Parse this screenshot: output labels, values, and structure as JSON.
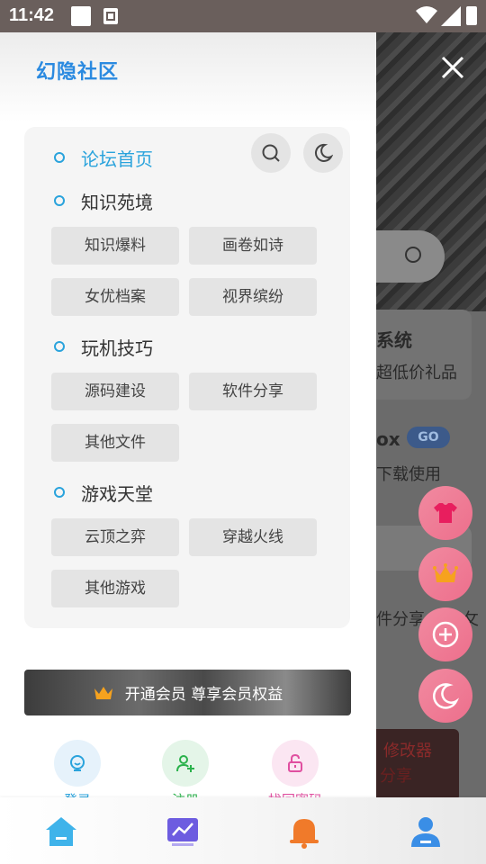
{
  "status_bar": {
    "time": "11:42"
  },
  "drawer": {
    "logo_text": "幻隐社区",
    "categories": [
      {
        "label": "论坛首页",
        "active": true
      },
      {
        "label": "知识苑境",
        "active": false,
        "subs": [
          "知识爆料",
          "画卷如诗",
          "女优档案",
          "视界缤纷"
        ]
      },
      {
        "label": "玩机技巧",
        "active": false,
        "subs": [
          "源码建设",
          "软件分享",
          "其他文件"
        ]
      },
      {
        "label": "游戏天堂",
        "active": false,
        "subs": [
          "云顶之弈",
          "穿越火线",
          "其他游戏"
        ]
      }
    ],
    "vip_banner": "开通会员 尊享会员权益",
    "actions": [
      {
        "label": "登录",
        "color": "#2aa3dc"
      },
      {
        "label": "注册",
        "color": "#2bb24c"
      },
      {
        "label": "找回密码",
        "color": "#e04fa0"
      }
    ]
  },
  "background_page": {
    "card1_title": "系统",
    "card1_sub": "超低价礼品",
    "card2_title": "ox",
    "card2_badge": "GO",
    "card2_sub": "下载使用",
    "card3_text": "件分享",
    "card3_suffix": "攵",
    "game_text_1": "修改器",
    "game_text_2": "分享"
  },
  "colors": {
    "accent": "#2aa3dc",
    "fab_pink": "#ee6f8c",
    "nav_home": "#3fb3ea",
    "nav_chart": "#6d5ce0",
    "nav_bell": "#f07a2a",
    "nav_user": "#3a8ee6"
  },
  "icons": {
    "fab": [
      "shirt-icon",
      "crown-icon",
      "plus-icon",
      "moon-icon"
    ],
    "bottom_nav": [
      "home-icon",
      "chart-icon",
      "bell-icon",
      "user-icon"
    ]
  }
}
